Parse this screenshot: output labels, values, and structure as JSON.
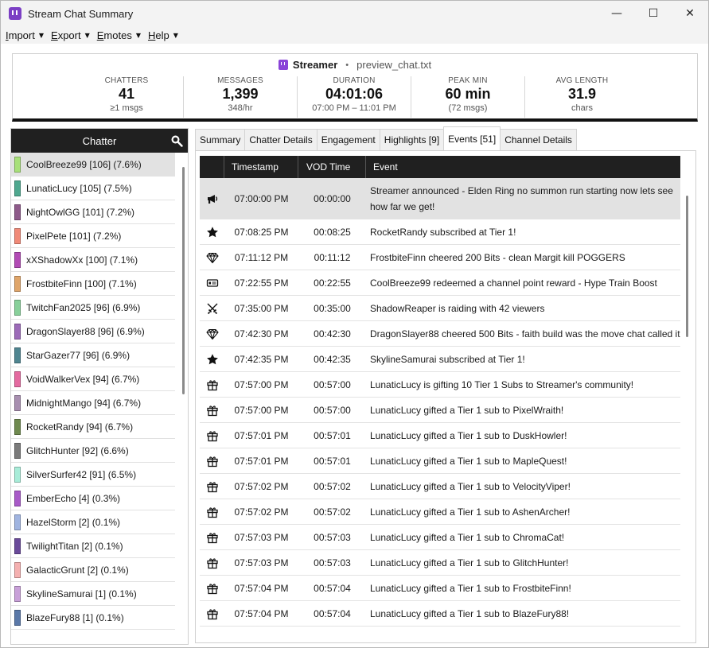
{
  "window": {
    "title": "Stream Chat Summary",
    "controls": {
      "minimize": "—",
      "maximize": "☐",
      "close": "✕"
    }
  },
  "menu": [
    {
      "label": "Import",
      "underline": "I",
      "rest": "mport"
    },
    {
      "label": "Export",
      "underline": "E",
      "rest": "xport"
    },
    {
      "label": "Emotes",
      "underline": "E",
      "rest": "motes"
    },
    {
      "label": "Help",
      "underline": "H",
      "rest": "elp"
    }
  ],
  "header": {
    "streamer": "Streamer",
    "separator": "•",
    "file": "preview_chat.txt",
    "stats": [
      {
        "label": "CHATTERS",
        "value": "41",
        "sub": "≥1 msgs"
      },
      {
        "label": "MESSAGES",
        "value": "1,399",
        "sub": "348/hr"
      },
      {
        "label": "DURATION",
        "value": "04:01:06",
        "sub": "07:00 PM – 11:01 PM"
      },
      {
        "label": "PEAK MIN",
        "value": "60 min",
        "sub": "(72 msgs)"
      },
      {
        "label": "AVG LENGTH",
        "value": "31.9",
        "sub": "chars"
      }
    ]
  },
  "chatters": {
    "title": "Chatter",
    "items": [
      {
        "label": "CoolBreeze99 [106] (7.6%)",
        "color": "#a8e07a",
        "selected": true
      },
      {
        "label": "LunaticLucy [105] (7.5%)",
        "color": "#4fa88f"
      },
      {
        "label": "NightOwlGG [101] (7.2%)",
        "color": "#8e5a8a"
      },
      {
        "label": "PixelPete [101] (7.2%)",
        "color": "#f08a78"
      },
      {
        "label": "xXShadowXx [100] (7.1%)",
        "color": "#b24bb5"
      },
      {
        "label": "FrostbiteFinn [100] (7.1%)",
        "color": "#dfa56a"
      },
      {
        "label": "TwitchFan2025 [96] (6.9%)",
        "color": "#88d09a"
      },
      {
        "label": "DragonSlayer88 [96] (6.9%)",
        "color": "#9c6bb8"
      },
      {
        "label": "StarGazer77 [96] (6.9%)",
        "color": "#4f8590"
      },
      {
        "label": "VoidWalkerVex [94] (6.7%)",
        "color": "#e46aa0"
      },
      {
        "label": "MidnightMango [94] (6.7%)",
        "color": "#a88fb0"
      },
      {
        "label": "RocketRandy [94] (6.7%)",
        "color": "#6f8a4f"
      },
      {
        "label": "GlitchHunter [92] (6.6%)",
        "color": "#7a7a7a"
      },
      {
        "label": "SilverSurfer42 [91] (6.5%)",
        "color": "#a8ecd8"
      },
      {
        "label": "EmberEcho [4] (0.3%)",
        "color": "#a85ac8"
      },
      {
        "label": "HazelStorm [2] (0.1%)",
        "color": "#a0b4e0"
      },
      {
        "label": "TwilightTitan [2] (0.1%)",
        "color": "#6a4a9a"
      },
      {
        "label": "GalacticGrunt [2] (0.1%)",
        "color": "#f4b0b0"
      },
      {
        "label": "SkylineSamurai [1] (0.1%)",
        "color": "#c8a0d8"
      },
      {
        "label": "BlazeFury88 [1] (0.1%)",
        "color": "#5a78a8"
      }
    ]
  },
  "tabs": [
    {
      "label": "Summary",
      "active": false
    },
    {
      "label": "Chatter Details",
      "active": false
    },
    {
      "label": "Engagement",
      "active": false
    },
    {
      "label": "Highlights [9]",
      "active": false
    },
    {
      "label": "Events [51]",
      "active": true
    },
    {
      "label": "Channel Details",
      "active": false
    }
  ],
  "events": {
    "columns": [
      "Timestamp",
      "VOD Time",
      "Event"
    ],
    "rows": [
      {
        "icon": "megaphone-icon",
        "ts": "07:00:00 PM",
        "vod": "00:00:00",
        "event": "Streamer announced - Elden Ring no summon run starting now lets see how far we get!",
        "tall": true,
        "selected": true
      },
      {
        "icon": "star-icon",
        "ts": "07:08:25 PM",
        "vod": "00:08:25",
        "event": "RocketRandy subscribed at Tier 1!"
      },
      {
        "icon": "diamond-icon",
        "ts": "07:11:12 PM",
        "vod": "00:11:12",
        "event": "FrostbiteFinn cheered 200 Bits - clean Margit kill POGGERS"
      },
      {
        "icon": "ticket-icon",
        "ts": "07:22:55 PM",
        "vod": "00:22:55",
        "event": "CoolBreeze99 redeemed a channel point reward - Hype Train Boost"
      },
      {
        "icon": "crossed-swords-icon",
        "ts": "07:35:00 PM",
        "vod": "00:35:00",
        "event": "ShadowReaper is raiding with 42 viewers"
      },
      {
        "icon": "diamond-icon",
        "ts": "07:42:30 PM",
        "vod": "00:42:30",
        "event": "DragonSlayer88 cheered 500 Bits - faith build was the move chat called it"
      },
      {
        "icon": "star-icon",
        "ts": "07:42:35 PM",
        "vod": "00:42:35",
        "event": "SkylineSamurai subscribed at Tier 1!"
      },
      {
        "icon": "gift-icon",
        "ts": "07:57:00 PM",
        "vod": "00:57:00",
        "event": "LunaticLucy is gifting 10 Tier 1 Subs to Streamer's community!"
      },
      {
        "icon": "gift-icon",
        "ts": "07:57:00 PM",
        "vod": "00:57:00",
        "event": "LunaticLucy gifted a Tier 1 sub to PixelWraith!"
      },
      {
        "icon": "gift-icon",
        "ts": "07:57:01 PM",
        "vod": "00:57:01",
        "event": "LunaticLucy gifted a Tier 1 sub to DuskHowler!"
      },
      {
        "icon": "gift-icon",
        "ts": "07:57:01 PM",
        "vod": "00:57:01",
        "event": "LunaticLucy gifted a Tier 1 sub to MapleQuest!"
      },
      {
        "icon": "gift-icon",
        "ts": "07:57:02 PM",
        "vod": "00:57:02",
        "event": "LunaticLucy gifted a Tier 1 sub to VelocityViper!"
      },
      {
        "icon": "gift-icon",
        "ts": "07:57:02 PM",
        "vod": "00:57:02",
        "event": "LunaticLucy gifted a Tier 1 sub to AshenArcher!"
      },
      {
        "icon": "gift-icon",
        "ts": "07:57:03 PM",
        "vod": "00:57:03",
        "event": "LunaticLucy gifted a Tier 1 sub to ChromaCat!"
      },
      {
        "icon": "gift-icon",
        "ts": "07:57:03 PM",
        "vod": "00:57:03",
        "event": "LunaticLucy gifted a Tier 1 sub to GlitchHunter!"
      },
      {
        "icon": "gift-icon",
        "ts": "07:57:04 PM",
        "vod": "00:57:04",
        "event": "LunaticLucy gifted a Tier 1 sub to FrostbiteFinn!"
      },
      {
        "icon": "gift-icon",
        "ts": "07:57:04 PM",
        "vod": "00:57:04",
        "event": "LunaticLucy gifted a Tier 1 sub to BlazeFury88!"
      }
    ]
  }
}
